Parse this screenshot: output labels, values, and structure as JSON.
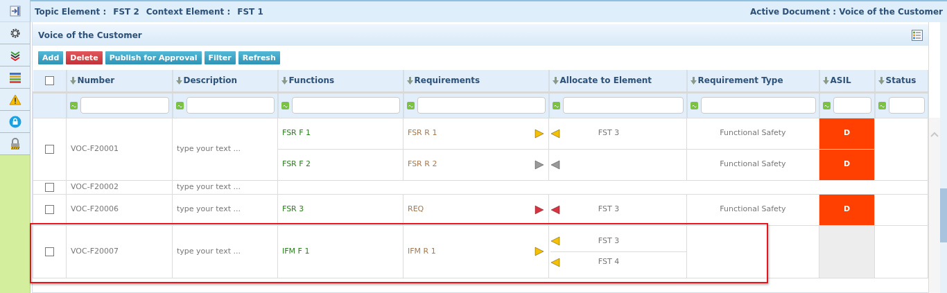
{
  "context_bar": {
    "topic_label": "Topic Element :",
    "topic_value": "FST 2",
    "context_label": "Context Element :",
    "context_value": "FST 1",
    "active_document": "Active Document : Voice of the Customer"
  },
  "panel": {
    "title": "Voice of the Customer"
  },
  "toolbar": [
    {
      "label": "Add",
      "kind": "info"
    },
    {
      "label": "Delete",
      "kind": "danger"
    },
    {
      "label": "Publish for Approval",
      "kind": "info"
    },
    {
      "label": "Filter",
      "kind": "info"
    },
    {
      "label": "Refresh",
      "kind": "info"
    }
  ],
  "table": {
    "select_all": {
      "checked": false
    },
    "columns": [
      "Number",
      "Description",
      "Functions",
      "Requirements",
      "Allocate to Element",
      "Requirement Type",
      "ASIL",
      "Status"
    ],
    "rows": [
      {
        "checked": false,
        "number": "VOC-F20001",
        "description": "type your text ...",
        "highlighted": false,
        "links": [
          {
            "function": "FSR F 1",
            "requirement": "FSR R 1",
            "color": "#f5c000",
            "allocations": [
              {
                "element": "FST 3",
                "color": "#f5c000"
              }
            ],
            "requirement_type": "Functional Safety",
            "asil": "D"
          },
          {
            "function": "FSR F 2",
            "requirement": "FSR R 2",
            "color": "#9a9a9a",
            "allocations": [
              {
                "color": "#9a9a9a"
              }
            ],
            "requirement_type": "Functional Safety",
            "asil": "D"
          }
        ]
      },
      {
        "checked": false,
        "number": "VOC-F20002",
        "description": "type your text ...",
        "highlighted": false
      },
      {
        "checked": false,
        "number": "VOC-F20006",
        "description": "type your text ...",
        "highlighted": false,
        "links": [
          {
            "function": "FSR 3",
            "requirement": "REQ",
            "color": "#d9333f",
            "allocations": [
              {
                "element": "FST 3",
                "color": "#d9333f"
              }
            ],
            "requirement_type": "Functional Safety",
            "asil": "D"
          }
        ]
      },
      {
        "checked": false,
        "number": "VOC-F20007",
        "description": "type your text ...",
        "highlighted": true,
        "links": [
          {
            "function": "IFM F 1",
            "requirement": "IFM R 1",
            "color": "#f5c000",
            "allocations": [
              {
                "element": "FST 3",
                "color": "#f5c000"
              },
              {
                "element": "FST 4",
                "color": "#f5c000"
              }
            ]
          }
        ]
      }
    ]
  }
}
